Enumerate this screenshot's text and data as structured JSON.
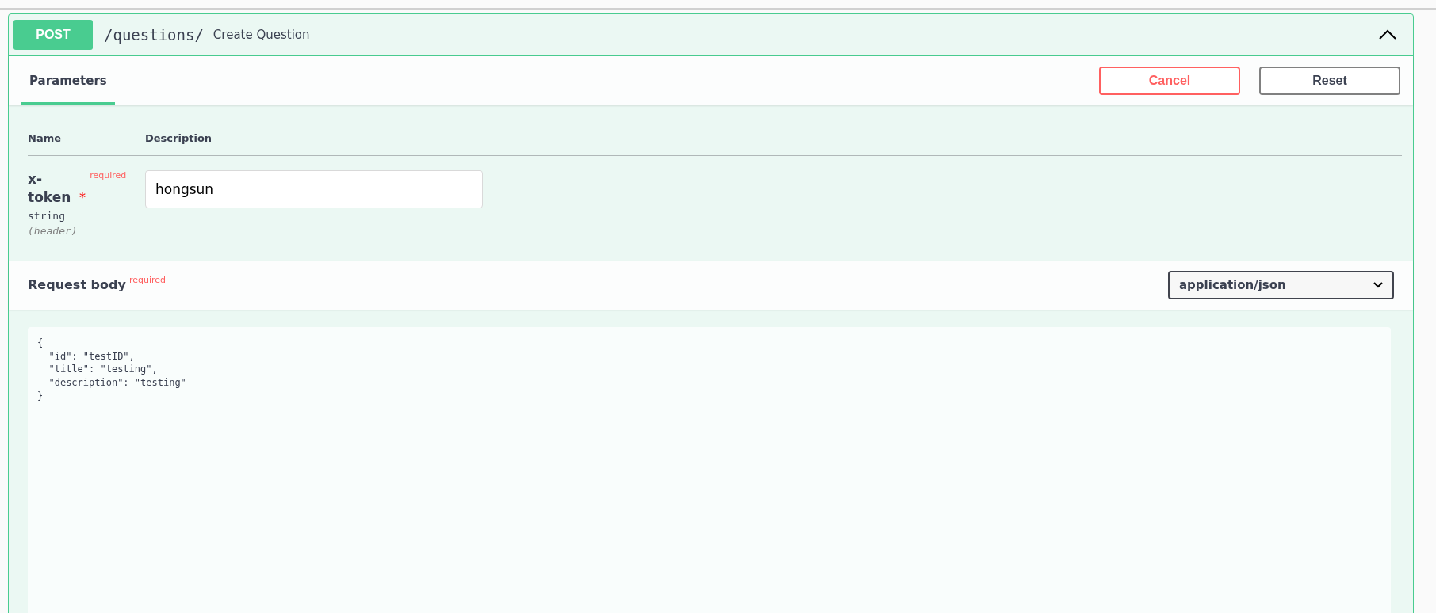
{
  "operation": {
    "method": "POST",
    "path": "/questions/",
    "summary": "Create Question",
    "expanded": true
  },
  "tabs": [
    {
      "label": "Parameters",
      "selected": true
    }
  ],
  "buttons": [
    {
      "label": "Cancel",
      "kind": "cancel"
    },
    {
      "label": "Reset",
      "kind": "reset"
    }
  ],
  "parameters": {
    "columns": [
      "Name",
      "Description"
    ],
    "rows": [
      {
        "name": "x-token",
        "required_mark": "*",
        "required": "required",
        "type": "string",
        "location": "(header)",
        "value": "hongsun"
      }
    ]
  },
  "request_body": {
    "title": "Request body",
    "required": "required",
    "content_type": "application/json",
    "body": "{\n  \"id\": \"testID\",\n  \"title\": \"testing\",\n  \"description\": \"testing\"\n}"
  }
}
